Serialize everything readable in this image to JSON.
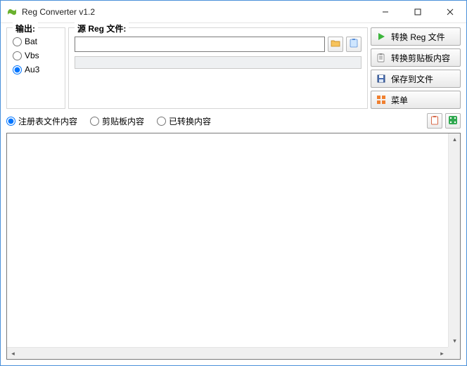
{
  "title": "Reg Converter v1.2",
  "output": {
    "legend": "输出:",
    "options": [
      "Bat",
      "Vbs",
      "Au3"
    ],
    "selected": "Au3"
  },
  "source": {
    "legend": "源 Reg 文件:",
    "path": ""
  },
  "actions": {
    "convert_reg": "转换 Reg 文件",
    "convert_clipboard": "转换剪贴板内容",
    "save_to_file": "保存到文件",
    "menu": "菜单"
  },
  "view": {
    "options": {
      "reg_file": "注册表文件内容",
      "clipboard": "剪贴板内容",
      "converted": "已转换内容"
    },
    "selected": "reg_file"
  },
  "content": ""
}
